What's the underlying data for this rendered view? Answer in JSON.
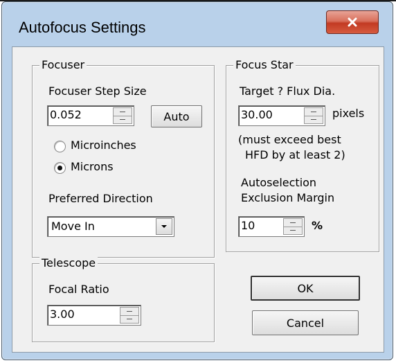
{
  "window": {
    "title": "Autofocus Settings",
    "close_glyph": "X"
  },
  "focuser": {
    "group_title": "Focuser",
    "step_size_label": "Focuser Step Size",
    "step_size_value": "0.052",
    "auto_button": "Auto",
    "units_options": [
      {
        "label": "Microinches",
        "selected": false
      },
      {
        "label": "Microns",
        "selected": true
      }
    ],
    "preferred_direction_label": "Preferred Direction",
    "preferred_direction_value": "Move In"
  },
  "focus_star": {
    "group_title": "Focus Star",
    "target_label": "Target ? Flux Dia.",
    "target_value": "30.00",
    "target_unit": "pixels",
    "note_line1": "(must exceed best",
    "note_line2": "HFD by at least 2)",
    "autoselection_line1": "Autoselection",
    "autoselection_line2": "Exclusion Margin",
    "margin_value": "10",
    "margin_unit": "%"
  },
  "telescope": {
    "group_title": "Telescope",
    "focal_ratio_label": "Focal Ratio",
    "focal_ratio_value": "3.00"
  },
  "buttons": {
    "ok": "OK",
    "cancel": "Cancel"
  },
  "colors": {
    "frame": "#b9d1ea",
    "client": "#f0f0f0",
    "close_button": "#c23a22"
  }
}
